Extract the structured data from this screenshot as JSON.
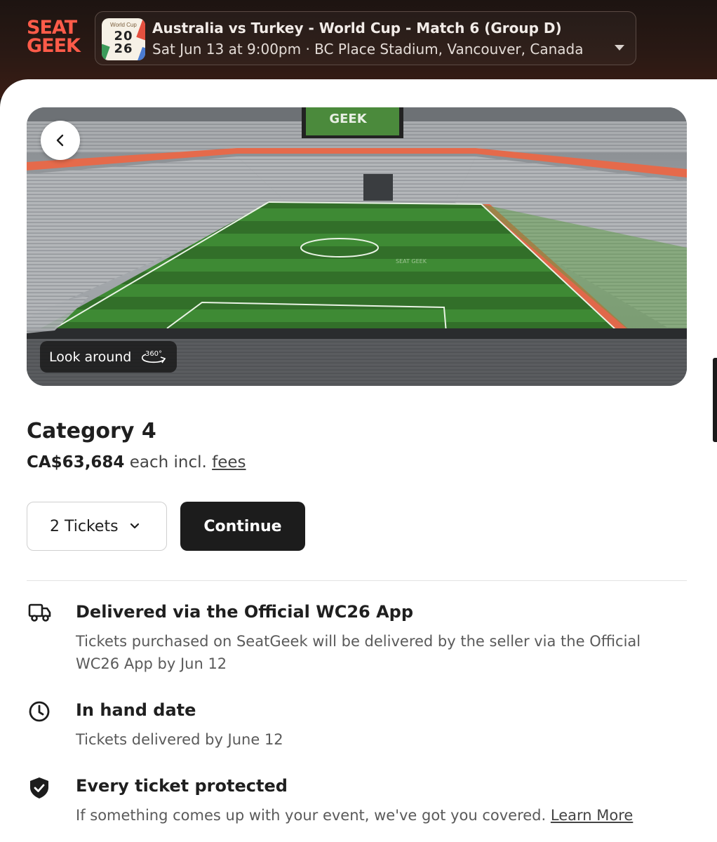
{
  "header": {
    "logo_line1": "SEAT",
    "logo_line2": "GEEK",
    "badge_top": "World Cup",
    "badge_year_top": "20",
    "badge_year_bottom": "26",
    "event_title": "Australia vs Turkey - World Cup - Match 6 (Group D)",
    "event_subtitle": "Sat Jun 13 at 9:00pm · BC Place Stadium, Vancouver, Canada",
    "event_dropdown_icon": "caret-down-icon"
  },
  "hero": {
    "back_icon": "chevron-left-icon",
    "look_around_label": "Look around",
    "view_360_icon": "rotate-360-icon",
    "view_360_label": "360°",
    "scoreboard_text": "GEEK",
    "pitch_watermark": "SEAT GEEK"
  },
  "listing": {
    "category": "Category 4",
    "price": "CA$63,684",
    "price_suffix": " each incl. ",
    "fees_link": "fees",
    "quantity_selected": "2 Tickets",
    "continue_label": "Continue"
  },
  "features": [
    {
      "icon": "truck-icon",
      "title": "Delivered via the Official WC26 App",
      "description": "Tickets purchased on SeatGeek will be delivered by the seller via the Official WC26 App by Jun 12"
    },
    {
      "icon": "clock-icon",
      "title": "In hand date",
      "description": "Tickets delivered by June 12"
    },
    {
      "icon": "shield-check-icon",
      "title": "Every ticket protected",
      "description": "If something comes up with your event, we've got you covered. ",
      "link": "Learn More"
    }
  ],
  "colors": {
    "brand_red": "#ff5b49",
    "header_bg": "#2a1914",
    "button_dark": "#1c1c1c",
    "pitch_green": "#3f8a36"
  }
}
